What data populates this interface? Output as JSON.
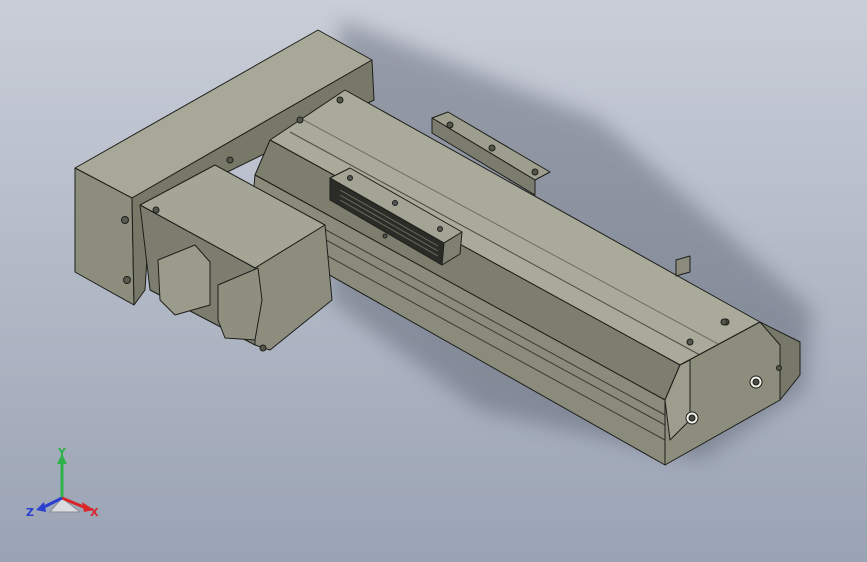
{
  "viewport": {
    "background_top": "#c9ced8",
    "background_bottom": "#9aa3b4"
  },
  "model": {
    "body_color": "#8e8f80",
    "edge_color": "#1e1e1a"
  },
  "triad": {
    "x_label": "X",
    "y_label": "Y",
    "z_label": "Z",
    "x_color": "#d8262a",
    "y_color": "#2eb34a",
    "z_color": "#2a3fd0"
  }
}
